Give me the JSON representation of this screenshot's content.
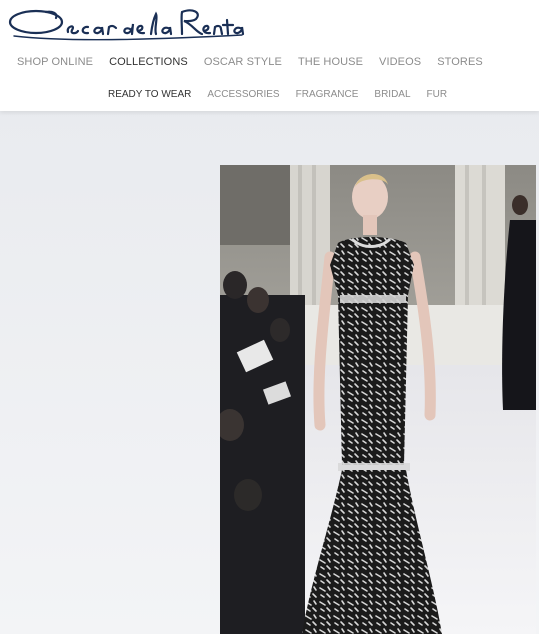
{
  "brand": {
    "logo_text": "Oscar de la Renta",
    "color": "#1a2f55"
  },
  "nav": {
    "primary": [
      {
        "label": "SHOP ONLINE"
      },
      {
        "label": "COLLECTIONS",
        "active": true
      },
      {
        "label": "OSCAR STYLE"
      },
      {
        "label": "THE HOUSE"
      },
      {
        "label": "VIDEOS"
      },
      {
        "label": "STORES"
      }
    ],
    "secondary": [
      {
        "label": "READY TO WEAR",
        "active": true
      },
      {
        "label": "ACCESSORIES"
      },
      {
        "label": "FRAGRANCE"
      },
      {
        "label": "BRIDAL"
      },
      {
        "label": "FUR"
      }
    ]
  },
  "colors": {
    "nav_text": "#8c8c8c",
    "nav_active": "#333333",
    "background": "#eceef1"
  }
}
